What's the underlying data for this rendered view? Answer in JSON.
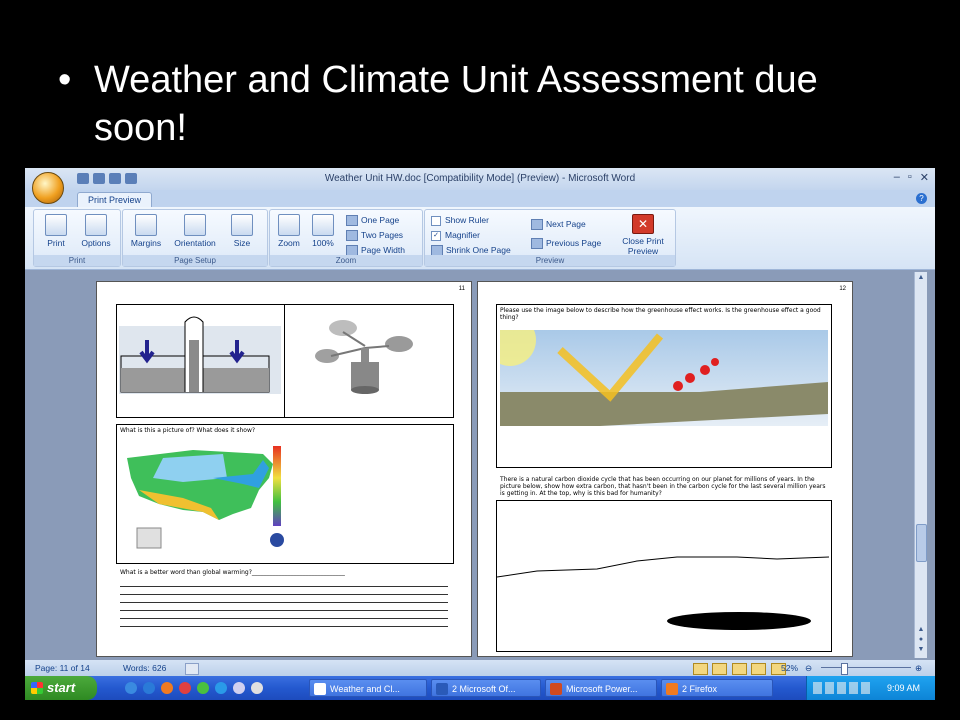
{
  "slide": {
    "bullet": "•",
    "text": "Weather and Climate Unit Assessment due soon!"
  },
  "window": {
    "title": "Weather Unit HW.doc [Compatibility Mode] (Preview) - Microsoft Word",
    "tab": "Print Preview",
    "help": "?",
    "minimize": "–",
    "restore": "▫",
    "close": "✕"
  },
  "ribbon": {
    "print_group": {
      "label": "Print",
      "print": "Print",
      "options": "Options"
    },
    "page_setup_group": {
      "label": "Page Setup",
      "margins": "Margins",
      "orientation": "Orientation",
      "size": "Size"
    },
    "zoom_group": {
      "label": "Zoom",
      "zoom": "Zoom",
      "hundred": "100%",
      "one_page": "One Page",
      "two_pages": "Two Pages",
      "page_width": "Page Width"
    },
    "preview_group": {
      "label": "Preview",
      "show_ruler": "Show Ruler",
      "magnifier": "Magnifier",
      "shrink": "Shrink One Page",
      "next_page": "Next Page",
      "prev_page": "Previous Page",
      "close_print": "Close Print",
      "close_preview": "Preview"
    }
  },
  "document": {
    "page11": {
      "number": "11",
      "q1": "What is this a picture of? What does it show?",
      "q2": "What is a better word than global warming?_______________________________"
    },
    "page12": {
      "number": "12",
      "q1": "Please use the image below to describe how the greenhouse effect works. Is the greenhouse effect a good thing?",
      "q2": "There is a natural carbon dioxide cycle that has been occurring on our planet for millions of years. In the picture below, show how extra carbon, that hasn't been in the carbon cycle for the last several million years is getting in. At the top, why is this bad for humanity?"
    }
  },
  "status": {
    "page": "Page: 11 of 14",
    "words": "Words: 626",
    "zoom": "52%"
  },
  "taskbar": {
    "start": "start",
    "tasks": [
      "Weather and Cl...",
      "2 Microsoft Of...",
      "Microsoft Power...",
      "2 Firefox"
    ],
    "clock": "9:09 AM"
  }
}
